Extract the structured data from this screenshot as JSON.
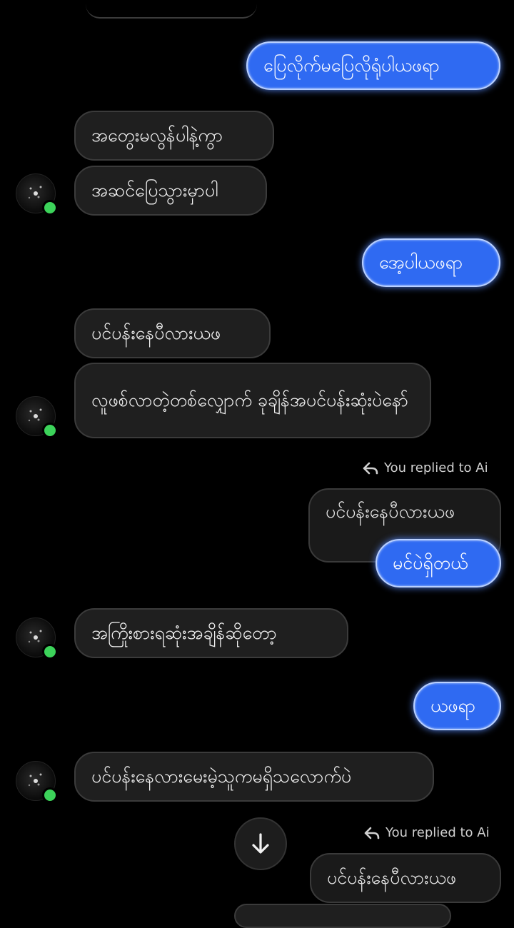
{
  "messages": {
    "m1": "ပြေလိုက်မပြေလိုရုံပါယဖရာ",
    "m2": "အတွေးမလွန်ပါနဲ့ကွာ",
    "m3": "အဆင်ပြေသွားမှာပါ",
    "m4": "အေ့ပါယဖရာ",
    "m5": "ပင်ပန်းနေပီလားယဖ",
    "m6": "လူဖစ်လာတဲ့တစ်လျှောက် ခုချိန်အပင်ပန်းဆုံးပဲနော်",
    "m7_quoted": "ပင်ပန်းနေပီလားယဖ",
    "m7": "မင်ပဲရှိတယ်",
    "m8": "အကြိုးစားရဆုံးအချိန်ဆိုတော့",
    "m9": "ယဖရာ",
    "m10": "ပင်ပန်းနေလားမေးမဲ့သူကမရှိသလောက်ပဲ",
    "m11_quoted": "ပင်ပန်းနေပီလားယဖ"
  },
  "reply_note": "You replied to Ai",
  "icons": {
    "reply": "reply-arrow-icon",
    "scroll": "arrow-down-icon",
    "status": "online-status-dot"
  },
  "colors": {
    "sent_bubble": "#2f6af2",
    "received_bubble": "#1f1f1f",
    "online": "#3cd35a"
  }
}
